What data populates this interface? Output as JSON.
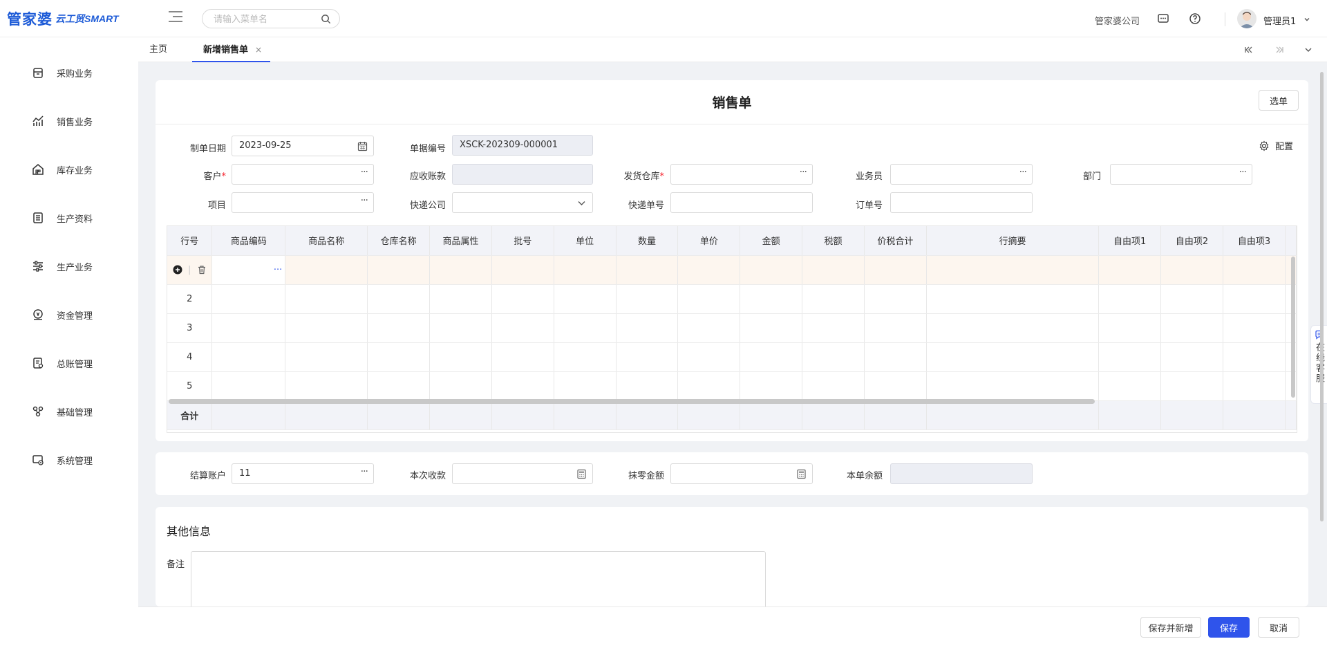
{
  "header": {
    "logo_main": "管家婆",
    "logo_sub": "云工贸SMART",
    "search_placeholder": "请输入菜单名",
    "company": "管家婆公司",
    "user_name": "管理员1"
  },
  "sidebar": {
    "items": [
      {
        "label": "采购业务",
        "icon": "purchase-icon"
      },
      {
        "label": "销售业务",
        "icon": "sales-chart-icon"
      },
      {
        "label": "库存业务",
        "icon": "warehouse-icon"
      },
      {
        "label": "生产资料",
        "icon": "document-list-icon"
      },
      {
        "label": "生产业务",
        "icon": "sliders-icon"
      },
      {
        "label": "资金管理",
        "icon": "money-icon"
      },
      {
        "label": "总账管理",
        "icon": "ledger-icon"
      },
      {
        "label": "基础管理",
        "icon": "base-settings-icon"
      },
      {
        "label": "系统管理",
        "icon": "system-icon"
      }
    ]
  },
  "tabs": {
    "home": "主页",
    "active": "新增销售单",
    "close": "×"
  },
  "form": {
    "title": "销售单",
    "select_button": "选单",
    "config_label": "配置",
    "fields": {
      "date_label": "制单日期",
      "date_value": "2023-09-25",
      "doc_no_label": "单据编号",
      "doc_no_value": "XSCK-202309-000001",
      "customer_label": "客户",
      "receivable_label": "应收账款",
      "warehouse_label": "发货仓库",
      "salesman_label": "业务员",
      "department_label": "部门",
      "project_label": "项目",
      "courier_label": "快递公司",
      "tracking_label": "快递单号",
      "order_no_label": "订单号",
      "required_mark": "*",
      "dots": "···"
    }
  },
  "table": {
    "columns": [
      "行号",
      "商品编码",
      "商品名称",
      "仓库名称",
      "商品属性",
      "批号",
      "单位",
      "数量",
      "单价",
      "金额",
      "税额",
      "价税合计",
      "行摘要",
      "自由项1",
      "自由项2",
      "自由项3"
    ],
    "row_numbers": [
      "2",
      "3",
      "4",
      "5"
    ],
    "sum_label": "合计",
    "code_dots": "···"
  },
  "settlement": {
    "account_label": "结算账户",
    "account_value": "11",
    "receive_label": "本次收款",
    "discount_label": "抹零金额",
    "balance_label": "本单余额"
  },
  "other": {
    "title": "其他信息",
    "remark_label": "备注"
  },
  "footer": {
    "save_new": "保存并新增",
    "save": "保存",
    "cancel": "取消"
  },
  "service": {
    "label": "在线客服"
  },
  "colors": {
    "primary": "#2f54eb",
    "brand": "#1d5bd7",
    "required": "#f5222d",
    "first_row": "#fdf6ef",
    "header_bg": "#f2f3f8"
  }
}
